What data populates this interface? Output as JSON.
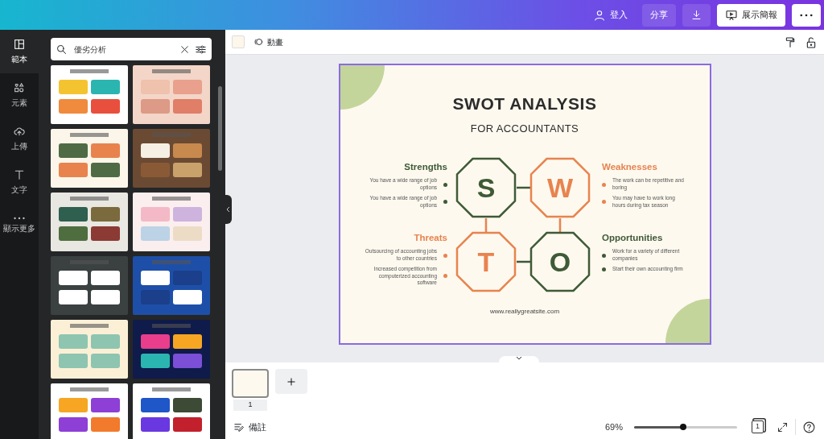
{
  "topbar": {
    "login": "登入",
    "share": "分享",
    "present": "展示簡報"
  },
  "rail": [
    {
      "label": "範本",
      "selected": true
    },
    {
      "label": "元素",
      "selected": false
    },
    {
      "label": "上傳",
      "selected": false
    },
    {
      "label": "文字",
      "selected": false
    },
    {
      "label": "顯示更多",
      "selected": false
    }
  ],
  "search": {
    "value": "優劣分析"
  },
  "toolbar": {
    "animate": "動畫"
  },
  "slide": {
    "title": "SWOT ANALYSIS",
    "subtitle": "FOR ACCOUNTANTS",
    "footer": "www.reallygreatsite.com",
    "quadrants": [
      {
        "letter": "S",
        "heading": "Strengths",
        "color": "#3f5a36",
        "points": [
          "You have a wide range of job options",
          "You have a wide range of job options"
        ]
      },
      {
        "letter": "W",
        "heading": "Weaknesses",
        "color": "#e8834e",
        "points": [
          "The work can be repetitive and boring",
          "You may have to work long hours during tax season"
        ]
      },
      {
        "letter": "T",
        "heading": "Threats",
        "color": "#e8834e",
        "points": [
          "Outsourcing of accounting jobs to other countries",
          "Increased competition from computerized accounting software"
        ]
      },
      {
        "letter": "O",
        "heading": "Opportunities",
        "color": "#3f5a36",
        "points": [
          "Work for a variety of different companies",
          "Start their own accounting firm"
        ]
      }
    ]
  },
  "pages": [
    {
      "number": "1",
      "selected": true
    }
  ],
  "bottombar": {
    "notes": "備註",
    "zoom": "69%",
    "level": 0.48,
    "page_count": "1"
  }
}
